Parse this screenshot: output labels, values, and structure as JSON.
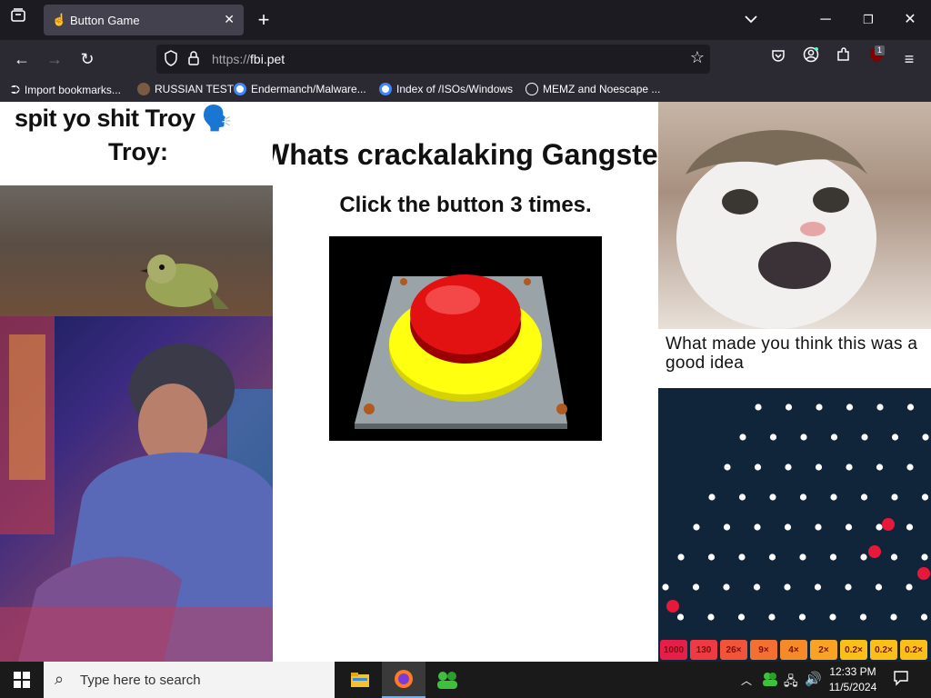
{
  "browser": {
    "tab_title": "Button Game",
    "url_prefix": "https://",
    "url_host": "fbi.pet",
    "extension_badge": "1",
    "bookmarks": [
      {
        "label": "Import bookmarks..."
      },
      {
        "label": "RUSSIAN TEST"
      },
      {
        "label": "Endermanch/Malware..."
      },
      {
        "label": "Index of /ISOs/Windows"
      },
      {
        "label": "MEMZ and Noescape ..."
      }
    ]
  },
  "page": {
    "meme_left_line1": "spit yo shit Troy 🗣️",
    "meme_left_line2": "Troy:",
    "heading": "Whats crackalaking Gangster",
    "instruction": "Click the button 3 times.",
    "meme_right_caption": "What made you think this was a good idea",
    "plinko_multipliers": [
      "1000",
      "130",
      "26×",
      "9×",
      "4×",
      "2×",
      "0.2×",
      "0.2×",
      "0.2×"
    ]
  },
  "taskbar": {
    "search_placeholder": "Type here to search",
    "time": "12:33 PM",
    "date": "11/5/2024"
  }
}
